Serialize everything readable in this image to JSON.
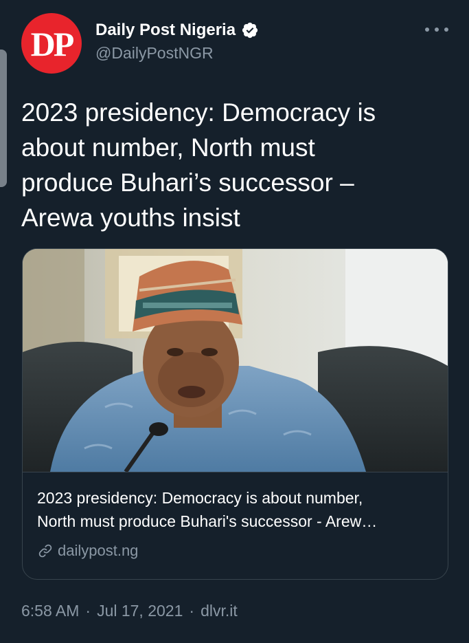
{
  "author": {
    "avatar_text": "DP",
    "display_name": "Daily Post Nigeria",
    "handle": "@DailyPostNGR",
    "verified": true,
    "avatar_color": "#e8242c"
  },
  "more_menu_icon": "more-horizontal-icon",
  "tweet": {
    "text_lines": [
      "2023 presidency: Democracy is",
      "about number, North must",
      "produce Buhari’s successor –",
      "Arewa youths insist"
    ]
  },
  "card": {
    "image_icon": "photo-man-speaking-at-microphone",
    "title_lines": [
      "2023 presidency: Democracy is about number,",
      "North must produce Buhari's successor - Arew…"
    ],
    "domain": "dailypost.ng",
    "link_icon": "link-icon"
  },
  "meta": {
    "time": "6:58 AM",
    "separator": "·",
    "date": "Jul 17, 2021",
    "source": "dlvr.it"
  },
  "colors": {
    "background": "#15202b",
    "secondary_text": "#8b98a5",
    "border": "#38444d",
    "verified_badge": "#ffffff"
  }
}
